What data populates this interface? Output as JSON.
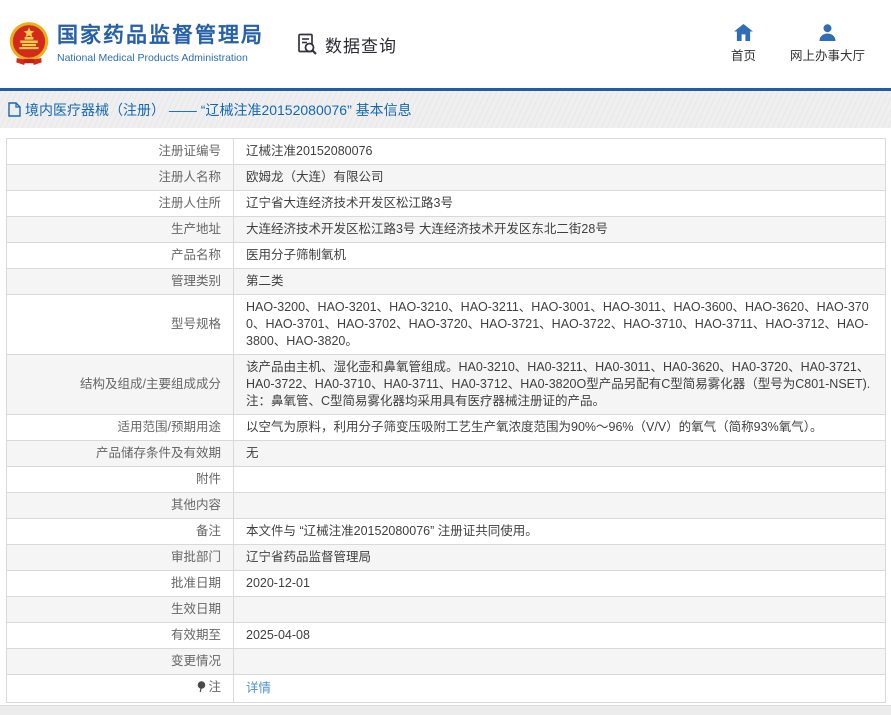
{
  "header": {
    "org_name_cn": "国家药品监督管理局",
    "org_name_en": "National Medical Products Administration",
    "emblem_icon": "china-national-emblem",
    "data_query_label": "数据查询",
    "data_query_icon": "document-search-icon",
    "nav": [
      {
        "label": "首页",
        "icon": "home-icon"
      },
      {
        "label": "网上办事大厅",
        "icon": "user-icon"
      }
    ]
  },
  "breadcrumb": {
    "icon": "document-icon",
    "text": "境内医疗器械（注册） —— “辽械注准20152080076” 基本信息"
  },
  "table": {
    "rows": [
      {
        "label": "注册证编号",
        "value": "辽械注准20152080076"
      },
      {
        "label": "注册人名称",
        "value": "欧姆龙（大连）有限公司"
      },
      {
        "label": "注册人住所",
        "value": "辽宁省大连经济技术开发区松江路3号"
      },
      {
        "label": "生产地址",
        "value": "大连经济技术开发区松江路3号 大连经济技术开发区东北二街28号"
      },
      {
        "label": "产品名称",
        "value": "医用分子筛制氧机"
      },
      {
        "label": "管理类别",
        "value": "第二类"
      },
      {
        "label": "型号规格",
        "value": "HAO-3200、HAO-3201、HAO-3210、HAO-3211、HAO-3001、HAO-3011、HAO-3600、HAO-3620、HAO-3700、HAO-3701、HAO-3702、HAO-3720、HAO-3721、HAO-3722、HAO-3710、HAO-3711、HAO-3712、HAO-3800、HAO-3820。"
      },
      {
        "label": "结构及组成/主要组成成分",
        "value": "该产品由主机、湿化壶和鼻氧管组成。HA0-3210、HA0-3211、HA0-3011、HA0-3620、HA0-3720、HA0-3721、HA0-3722、HA0-3710、HA0-3711、HA0-3712、HA0-3820O型产品另配有C型简易雾化器（型号为C801-NSET).注：鼻氧管、C型简易雾化器均采用具有医疗器械注册证的产品。"
      },
      {
        "label": "适用范围/预期用途",
        "value": "以空气为原料，利用分子筛变压吸附工艺生产氧浓度范围为90%～96%（V/V）的氧气（简称93%氧气）。"
      },
      {
        "label": "产品储存条件及有效期",
        "value": "无"
      },
      {
        "label": "附件",
        "value": ""
      },
      {
        "label": "其他内容",
        "value": ""
      },
      {
        "label": "备注",
        "value": "本文件与 “辽械注准20152080076” 注册证共同使用。"
      },
      {
        "label": "审批部门",
        "value": "辽宁省药品监督管理局"
      },
      {
        "label": "批准日期",
        "value": "2020-12-01"
      },
      {
        "label": "生效日期",
        "value": ""
      },
      {
        "label": "有效期至",
        "value": "2025-04-08"
      },
      {
        "label": "变更情况",
        "value": ""
      },
      {
        "label": "注",
        "value": "详情",
        "note_icon": "note-pin-icon",
        "value_is_link": true
      }
    ]
  },
  "colors": {
    "brand_blue": "#2660a8",
    "header_rule_blue": "#1b5fa8",
    "breadcrumb_blue": "#1468b3",
    "link_blue": "#4e8fd6",
    "table_border": "#d9d9d9",
    "zebra_row": "#f5f5f5",
    "emblem_red": "#d42a1d",
    "emblem_gold": "#f0c440"
  }
}
